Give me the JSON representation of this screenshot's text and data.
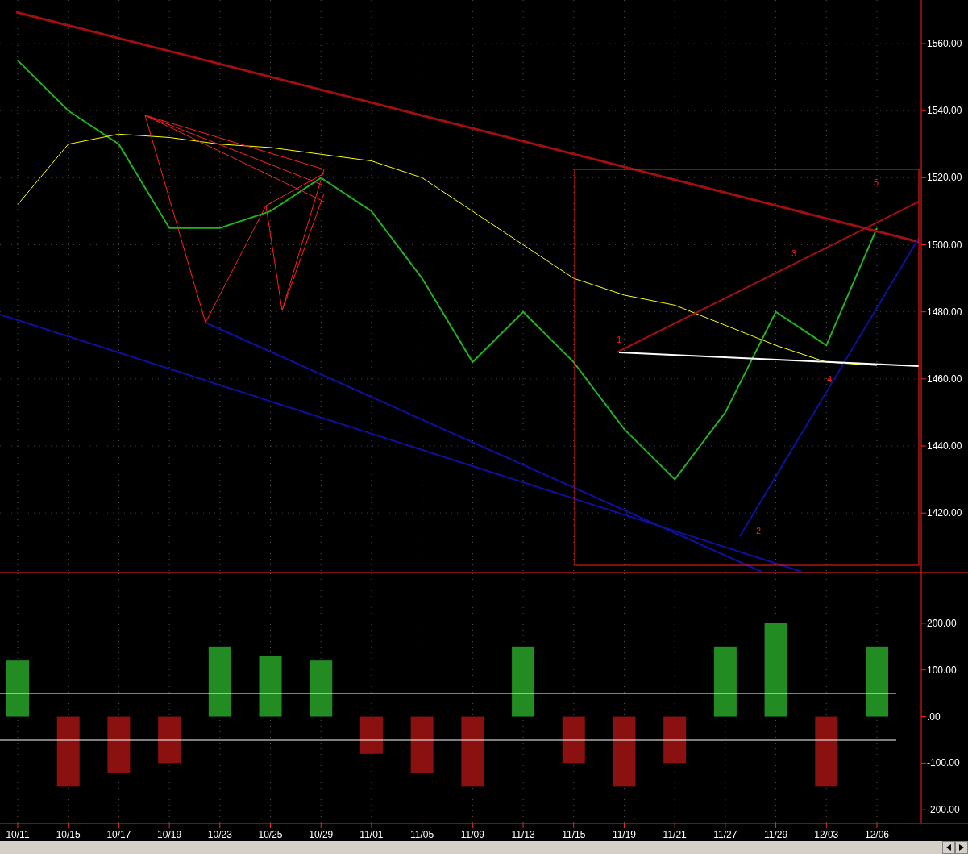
{
  "price_chart": {
    "chart_data": {
      "type": "line",
      "grid": true,
      "series": [
        {
          "color": "#22b022",
          "values": [
            1555,
            1540,
            1530,
            1505,
            1505,
            1510,
            1520,
            1510,
            1490,
            1465,
            1480,
            1465,
            1445,
            1430,
            1450,
            1480,
            1470,
            1505
          ]
        },
        {
          "color": "#ffff00",
          "values": [
            1512,
            1530,
            1533,
            1532,
            1530,
            1529,
            1527,
            1525,
            1520,
            1510,
            1500,
            1490,
            1485,
            1482,
            1476,
            1470,
            1465,
            1464
          ]
        }
      ],
      "ylim": [
        1402,
        1573
      ],
      "yticks": [
        {
          "value": 1560,
          "label": "1560.00"
        },
        {
          "value": 1540,
          "label": "1540.00"
        },
        {
          "value": 1520,
          "label": "1520.00"
        },
        {
          "value": 1500,
          "label": "1500.00"
        },
        {
          "value": 1480,
          "label": "1480.00"
        },
        {
          "value": 1460,
          "label": "1460.00"
        },
        {
          "value": 1440,
          "label": "1440.00"
        },
        {
          "value": 1420,
          "label": "1420.00"
        }
      ],
      "annotations": [
        "1",
        "2",
        "3",
        "4",
        "5"
      ]
    }
  },
  "oscillator": {
    "chart_data": {
      "type": "bar",
      "grid": true,
      "categories": [
        "10/11",
        "10/15",
        "10/17",
        "10/19",
        "10/23",
        "10/25",
        "10/29",
        "11/01",
        "11/05",
        "11/09",
        "11/13",
        "11/15",
        "11/19",
        "11/21",
        "11/27",
        "11/29",
        "12/03",
        "12/06"
      ],
      "series": [
        {
          "color": "#228b22",
          "values": [
            120,
            null,
            null,
            null,
            150,
            130,
            120,
            null,
            null,
            null,
            150,
            null,
            null,
            null,
            150,
            200,
            null,
            150
          ]
        },
        {
          "color": "#8b1010",
          "values": [
            null,
            -150,
            -120,
            -100,
            null,
            null,
            null,
            -80,
            -120,
            -150,
            null,
            -100,
            -150,
            -100,
            null,
            null,
            -150,
            null
          ]
        }
      ],
      "ylim": [
        -229,
        307
      ],
      "yticks": [
        {
          "value": 200,
          "label": "200.00"
        },
        {
          "value": 100,
          "label": "100.00"
        },
        {
          "value": 0,
          "label": ".00"
        },
        {
          "value": -100,
          "label": "-100.00"
        },
        {
          "value": -200,
          "label": "-200.00"
        }
      ]
    }
  }
}
